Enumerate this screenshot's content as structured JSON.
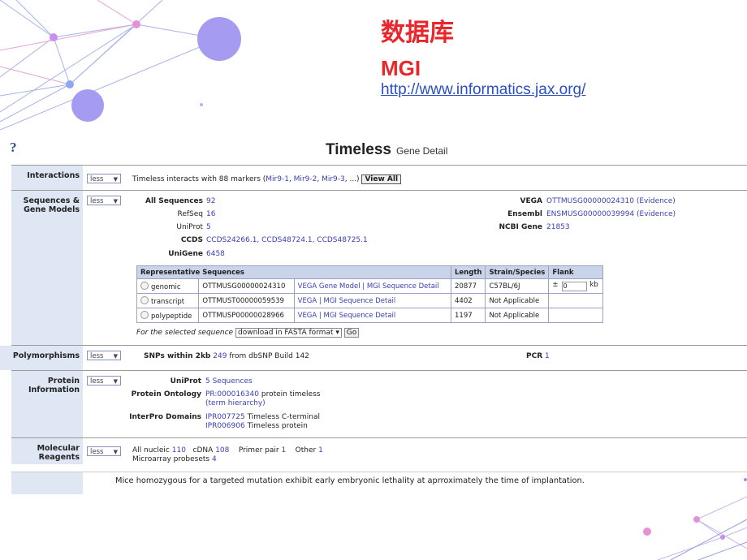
{
  "slide": {
    "title": "数据库",
    "subtitle": "MGI",
    "link": "http://www.informatics.jax.org/"
  },
  "header": {
    "help": "?",
    "gene": "Timeless",
    "detail": "Gene Detail"
  },
  "less_label": "less",
  "sections": {
    "interactions": {
      "label": "Interactions",
      "text_pre": "Timeless interacts with 88 markers (",
      "markers": [
        "Mir9-1",
        "Mir9-2",
        "Mir9-3"
      ],
      "text_post": ", ...)",
      "view_all": "View All"
    },
    "sequences": {
      "label": "Sequences & Gene Models",
      "all_sequences_label": "All Sequences",
      "all_sequences": "92",
      "refseq_label": "RefSeq",
      "refseq": "16",
      "uniprot_label": "UniProt",
      "uniprot": "5",
      "ccds_label": "CCDS",
      "ccds": "CCDS24266.1, CCDS48724.1, CCDS48725.1",
      "unigene_label": "UniGene",
      "unigene": "6458",
      "vega_label": "VEGA",
      "vega": "OTTMUSG00000024310",
      "vega_evidence": "(Evidence)",
      "ensembl_label": "Ensembl",
      "ensembl": "ENSMUSG00000039994",
      "ensembl_evidence": "(Evidence)",
      "ncbi_label": "NCBI Gene",
      "ncbi": "21853",
      "table_headers": [
        "Representative Sequences",
        "Length",
        "Strain/Species",
        "Flank"
      ],
      "rows": [
        {
          "type": "genomic",
          "id": "OTTMUSG00000024310",
          "links": "VEGA Gene Model | MGI Sequence Detail",
          "length": "20877",
          "strain": "C57BL/6J",
          "flank_prefix": "±",
          "flank_value": "0",
          "flank_unit": "kb"
        },
        {
          "type": "transcript",
          "id": "OTTMUST00000059539",
          "links": "VEGA | MGI Sequence Detail",
          "length": "4402",
          "strain": "Not Applicable",
          "flank_prefix": "",
          "flank_value": "",
          "flank_unit": ""
        },
        {
          "type": "polypeptide",
          "id": "OTTMUSP00000028966",
          "links": "VEGA | MGI Sequence Detail",
          "length": "1197",
          "strain": "Not Applicable",
          "flank_prefix": "",
          "flank_value": "",
          "flank_unit": ""
        }
      ],
      "selected_label": "For the selected sequence",
      "download_option": "download in FASTA format ▾",
      "go": "Go"
    },
    "polymorphisms": {
      "label": "Polymorphisms",
      "snps_label": "SNPs within 2kb",
      "snps": "249",
      "snps_suffix": "from dbSNP Build 142",
      "pcr_label": "PCR",
      "pcr": "1"
    },
    "protein": {
      "label": "Protein Information",
      "uniprot_label": "UniProt",
      "uniprot": "5 Sequences",
      "ontology_label": "Protein Ontology",
      "ontology_id": "PR:000016340",
      "ontology_text": "protein timeless",
      "ontology_link2": "(term hierarchy)",
      "interpro_label": "InterPro Domains",
      "interpro1_id": "IPR007725",
      "interpro1_text": "Timeless C-terminal",
      "interpro2_id": "IPR006906",
      "interpro2_text": "Timeless protein"
    },
    "reagents": {
      "label": "Molecular Reagents",
      "nucleic_label": "All nucleic",
      "nucleic": "110",
      "cdna_label": "cDNA",
      "cdna": "108",
      "primer_label": "Primer pair",
      "primer": "1",
      "other_label": "Other",
      "other": "1",
      "microarray_label": "Microarray probesets",
      "microarray": "4"
    }
  },
  "phenotype_text": "Mice homozygous for a targeted mutation exhibit early embryonic lethality at aprroximately the time of implantation.",
  "colors": {
    "title_red": "#e8262b",
    "link_blue": "#3a3fb5",
    "label_bg": "#dfe6f4",
    "deco_purple": "#9b8ff0",
    "deco_pink": "#e690d8"
  }
}
